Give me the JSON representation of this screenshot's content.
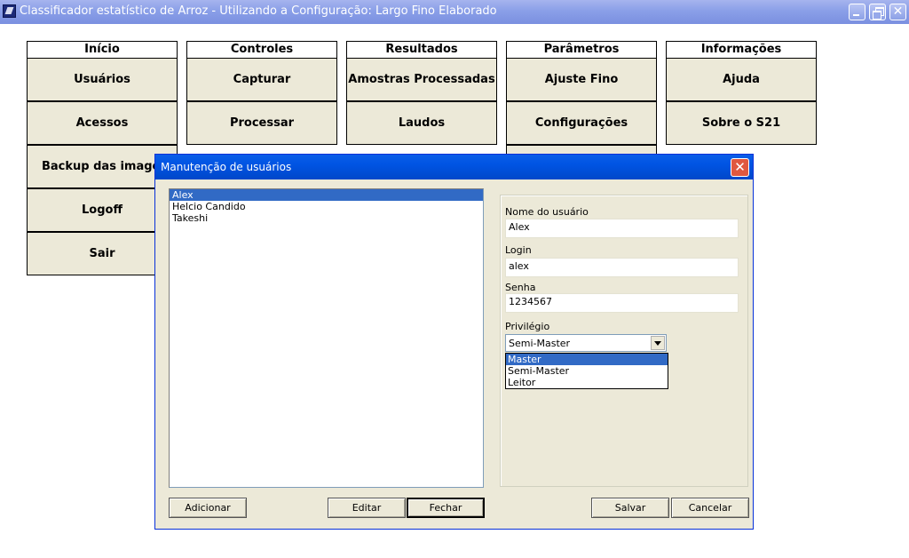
{
  "window": {
    "title": "Classificador estatístico de Arroz - Utilizando a Configuração: Largo Fino Elaborado",
    "close_glyph": "✕"
  },
  "menu": {
    "columns": [
      {
        "header": "Início",
        "items": [
          "Usuários",
          "Acessos",
          "Backup das imagens",
          "Logoff",
          "Sair"
        ]
      },
      {
        "header": "Controles",
        "items": [
          "Capturar",
          "Processar"
        ]
      },
      {
        "header": "Resultados",
        "items": [
          "Amostras Processadas",
          "Laudos"
        ]
      },
      {
        "header": "Parâmetros",
        "items": [
          "Ajuste Fino",
          "Configurações"
        ]
      },
      {
        "header": "Informações",
        "items": [
          "Ajuda",
          "Sobre o S21"
        ]
      }
    ]
  },
  "dialog": {
    "title": "Manutenção de usuários",
    "close_glyph": "✕",
    "users": [
      "Alex",
      "Helcio Candido",
      "Takeshi"
    ],
    "selected_user": "Alex",
    "fields": {
      "name_label": "Nome do usuário",
      "name_value": "Alex",
      "login_label": "Login",
      "login_value": "alex",
      "password_label": "Senha",
      "password_value": "1234567",
      "privilege_label": "Privilégio",
      "privilege_value": "Semi-Master"
    },
    "privilege_options": [
      "Master",
      "Semi-Master",
      "Leitor"
    ],
    "highlighted_option": "Master",
    "buttons": {
      "add": "Adicionar",
      "edit": "Editar",
      "close": "Fechar",
      "save": "Salvar",
      "cancel": "Cancelar"
    }
  },
  "colors": {
    "title_bar": "#8a9fe8",
    "dialog_title_bar": "#0054e3",
    "selection": "#316ac5",
    "button_face": "#ece9d8"
  }
}
